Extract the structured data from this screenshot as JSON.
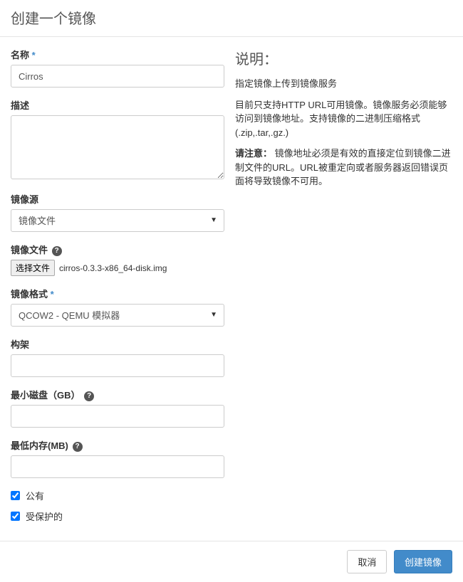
{
  "header": {
    "title": "创建一个镜像"
  },
  "form": {
    "name": {
      "label": "名称",
      "value": "Cirros"
    },
    "description": {
      "label": "描述",
      "value": ""
    },
    "source": {
      "label": "镜像源",
      "selected": "镜像文件"
    },
    "file": {
      "label": "镜像文件",
      "button": "选择文件",
      "filename": "cirros-0.3.3-x86_64-disk.img"
    },
    "format": {
      "label": "镜像格式",
      "selected": "QCOW2 - QEMU 模拟器"
    },
    "architecture": {
      "label": "构架",
      "value": ""
    },
    "min_disk": {
      "label": "最小磁盘（GB）",
      "value": ""
    },
    "min_ram": {
      "label": "最低内存(MB)",
      "value": ""
    },
    "public": {
      "label": "公有",
      "checked": true
    },
    "protected": {
      "label": "受保护的",
      "checked": true
    }
  },
  "help": {
    "title": "说明：",
    "p1": "指定镜像上传到镜像服务",
    "p2": "目前只支持HTTP URL可用镜像。镜像服务必须能够访问到镜像地址。支持镜像的二进制压缩格式(.zip,.tar,.gz.)",
    "p3_label": "请注意：",
    "p3_text": "镜像地址必须是有效的直接定位到镜像二进制文件的URL。URL被重定向或者服务器返回错误页面将导致镜像不可用。"
  },
  "footer": {
    "cancel": "取消",
    "submit": "创建镜像"
  }
}
